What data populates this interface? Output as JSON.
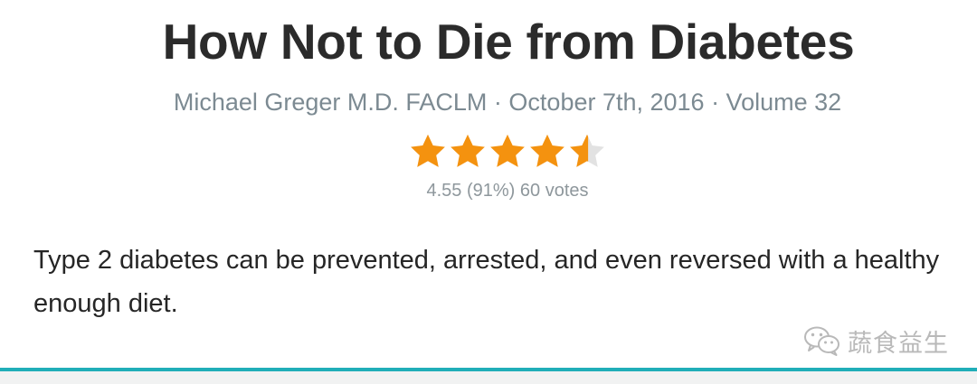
{
  "book": {
    "title": "How Not to Die from Diabetes",
    "meta": "Michael Greger M.D. FACLM · October 7th, 2016 · Volume 32",
    "description": "Type 2 diabetes can be prevented, arrested, and even reversed with a healthy enough diet."
  },
  "rating": {
    "stars_value": 4.55,
    "stars_max": 5,
    "summary": "4.55 (91%) 60 votes",
    "filled_color": "#f4920f",
    "empty_color": "#e2e2e2"
  },
  "watermark": {
    "icon": "wechat-icon",
    "text": "蔬食益生"
  },
  "theme": {
    "accent_rule_color": "#20aeb8"
  }
}
